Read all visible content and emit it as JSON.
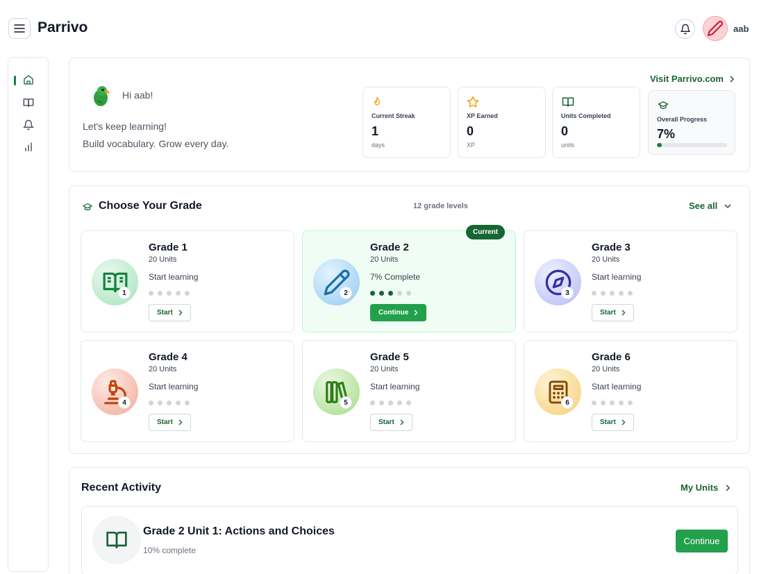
{
  "app": {
    "brand": "Parrivo",
    "username": "aab"
  },
  "welcome": {
    "greeting": "Hi aab!",
    "motto_line1": "Let's keep learning!",
    "motto_line2": "Build vocabulary. Grow every day.",
    "visit_link": "Visit Parrivo.com"
  },
  "stats": [
    {
      "label": "Current Streak",
      "value": "1",
      "unit": "days",
      "icon": "flame-icon"
    },
    {
      "label": "XP Earned",
      "value": "0",
      "unit": "XP",
      "icon": "star-icon"
    },
    {
      "label": "Units Completed",
      "value": "0",
      "unit": "units",
      "icon": "book-icon"
    }
  ],
  "progress": {
    "label": "Overall Progress",
    "value": "7%",
    "fraction": 0.07
  },
  "grades_section": {
    "title": "Choose Your Grade",
    "count": "12 grade levels",
    "see_all": "See all",
    "current_badge": "Current"
  },
  "grades": [
    {
      "name": "Grade 1",
      "units": "20 Units",
      "status": "Start learning",
      "button": "Start",
      "number": "1",
      "dots_filled": 0,
      "icon": "open-book-icon",
      "color": "#15803d"
    },
    {
      "name": "Grade 2",
      "units": "20 Units",
      "status": "7% Complete",
      "button": "Continue",
      "number": "2",
      "dots_filled": 3,
      "icon": "pencil-icon",
      "color": "#1e6fa8",
      "current": true
    },
    {
      "name": "Grade 3",
      "units": "20 Units",
      "status": "Start learning",
      "button": "Start",
      "number": "3",
      "dots_filled": 0,
      "icon": "compass-icon",
      "color": "#3730a3"
    },
    {
      "name": "Grade 4",
      "units": "20 Units",
      "status": "Start learning",
      "button": "Start",
      "number": "4",
      "dots_filled": 0,
      "icon": "microscope-icon",
      "color": "#c2410c"
    },
    {
      "name": "Grade 5",
      "units": "20 Units",
      "status": "Start learning",
      "button": "Start",
      "number": "5",
      "dots_filled": 0,
      "icon": "books-icon",
      "color": "#2f7d1a"
    },
    {
      "name": "Grade 6",
      "units": "20 Units",
      "status": "Start learning",
      "button": "Start",
      "number": "6",
      "dots_filled": 0,
      "icon": "calculator-icon",
      "color": "#8a4a06"
    }
  ],
  "recent": {
    "title": "Recent Activity",
    "my_units": "My Units",
    "item_title": "Grade 2 Unit 1: Actions and Choices",
    "item_progress": "10% complete",
    "item_button": "Continue"
  }
}
